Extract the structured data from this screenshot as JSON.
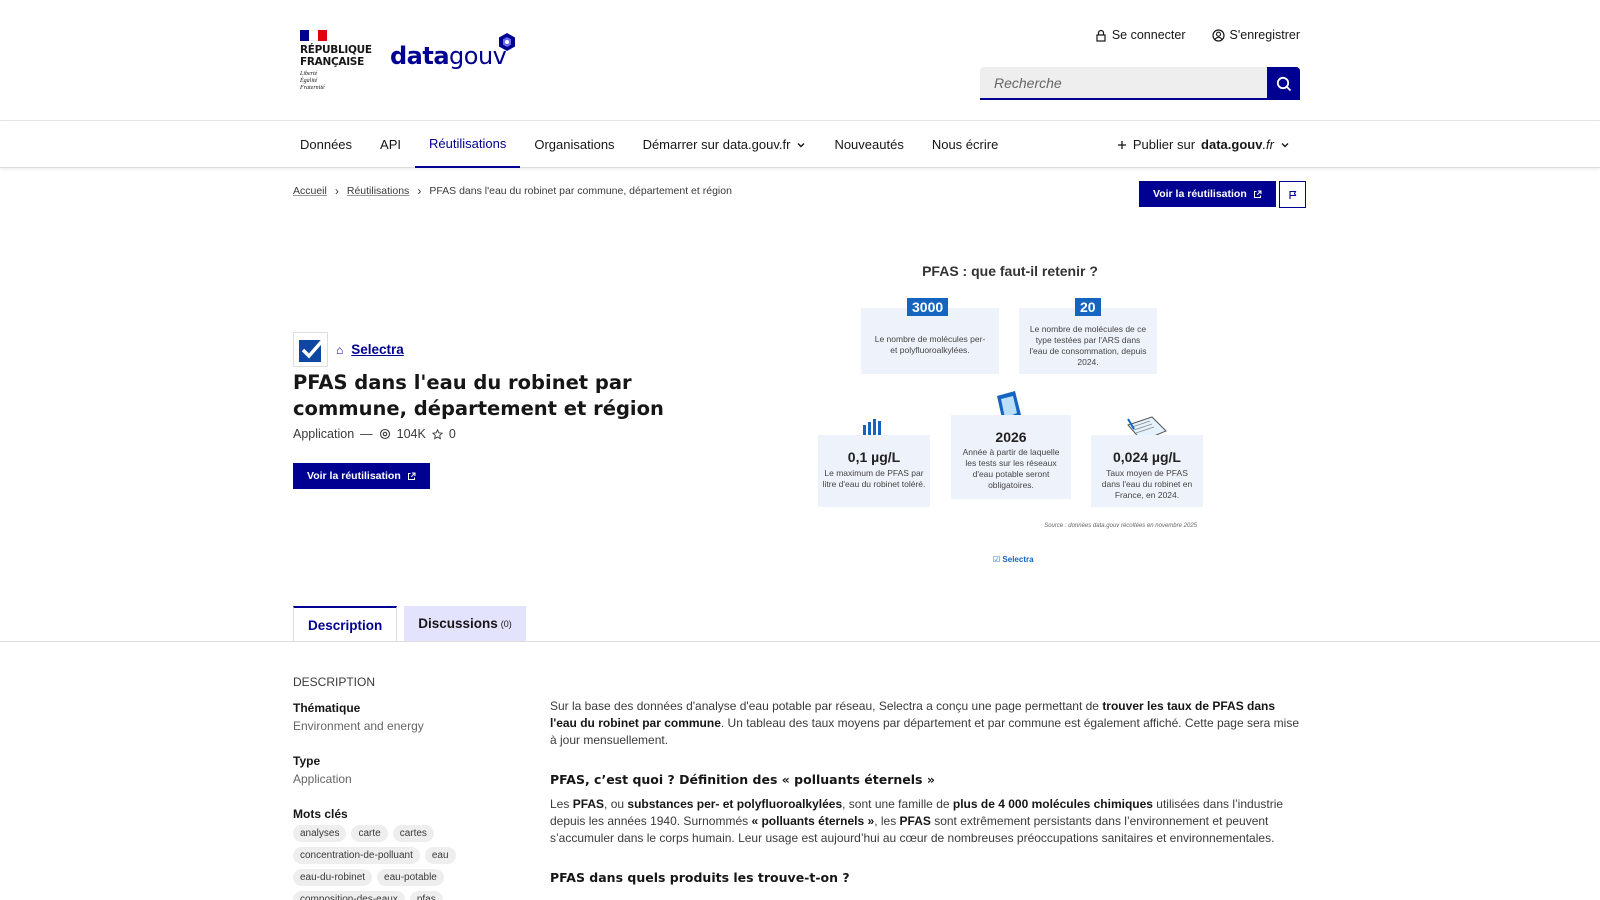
{
  "header": {
    "rf": {
      "line1": "RÉPUBLIQUE",
      "line2": "FRANÇAISE",
      "motto1": "Liberté",
      "motto2": "Égalité",
      "motto3": "Fraternité"
    },
    "brand": {
      "part1": "data",
      "part2": "gouv"
    },
    "login_label": "Se connecter",
    "register_label": "S'enregistrer",
    "search_placeholder": "Recherche"
  },
  "nav": {
    "items": [
      "Données",
      "API",
      "Réutilisations",
      "Organisations",
      "Démarrer sur data.gouv.fr",
      "Nouveautés",
      "Nous écrire"
    ],
    "active": "Réutilisations",
    "publish": {
      "prefix": "Publier sur",
      "site_bold": "data.gouv",
      "site_suffix": ".fr"
    }
  },
  "breadcrumb": [
    "Accueil",
    "Réutilisations",
    "PFAS dans l'eau du robinet par commune, département et région"
  ],
  "cta_label": "Voir la réutilisation",
  "reuse": {
    "organization": "Selectra",
    "title": "PFAS dans l'eau du robinet par commune, département et région",
    "type": "Application",
    "separator": "—",
    "views": "104K",
    "stars": "0"
  },
  "infographic": {
    "title": "PFAS : que faut-il retenir ?",
    "stats": [
      {
        "value": "3000",
        "desc": "Le nombre de molécules per- et polyfluoroalkylées."
      },
      {
        "value": "20",
        "desc": "Le nombre de molécules de ce type testées par l'ARS dans l'eau de consommation, depuis 2024."
      },
      {
        "value": "0,1 µg/L",
        "desc": "Le maximum de PFAS par litre d'eau du robinet toléré."
      },
      {
        "value": "2026",
        "desc": "Année à partir de laquelle les tests sur les réseaux d'eau potable seront obligatoires."
      },
      {
        "value": "0,024 µg/L",
        "desc": "Taux moyen de PFAS dans l'eau du robinet en France, en 2024."
      }
    ],
    "source": "Source : données data.gouv récoltées en novembre 2025",
    "brand": "Selectra"
  },
  "tabs": [
    {
      "label": "Description",
      "count": ""
    },
    {
      "label": "Discussions",
      "count": "(0)"
    }
  ],
  "sidebar": {
    "heading": "DESCRIPTION",
    "theme_label": "Thématique",
    "theme_value": "Environment and energy",
    "type_label": "Type",
    "type_value": "Application",
    "keywords_label": "Mots clés",
    "keywords": [
      "analyses",
      "carte",
      "cartes",
      "concentration-de-polluant",
      "eau",
      "eau-du-robinet",
      "eau-potable",
      "composition-des-eaux",
      "pfas"
    ]
  },
  "content": {
    "intro_1": "Sur la base des données d'analyse d'eau potable par réseau, Selectra a conçu une page permettant de ",
    "intro_bold": "trouver les taux de PFAS dans l'eau du robinet par commune",
    "intro_2": ". Un tableau des taux moyens par département et par commune est également affiché. Cette page sera mise à jour mensuellement.",
    "h1": "PFAS, c’est quoi ? Définition des « polluants éternels »",
    "p2_1": "Les ",
    "p2_b1": "PFAS",
    "p2_2": ", ou ",
    "p2_b2": "substances per- et polyfluoroalkylées",
    "p2_3": ", sont une famille de ",
    "p2_b3": "plus de 4 000 molécules chimiques",
    "p2_4": " utilisées dans l’industrie depuis les années 1940. Surnommés ",
    "p2_b4": "« polluants éternels »",
    "p2_5": ", les ",
    "p2_b5": "PFAS",
    "p2_6": " sont extrêmement persistants dans l’environnement et peuvent s’accumuler dans le corps humain. Leur usage est aujourd’hui au cœur de nombreuses préoccupations sanitaires et environnementales.",
    "h2": "PFAS dans quels produits les trouve-t-on ?"
  },
  "colors": {
    "primary": "#000091",
    "tab_inactive": "#e3e3fd",
    "info_accent": "#1565c0"
  }
}
